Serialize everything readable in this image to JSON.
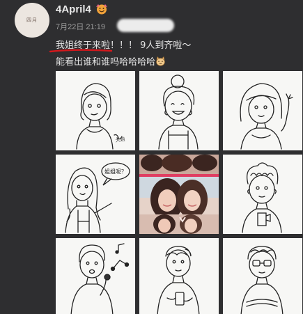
{
  "post": {
    "avatar_text": "四月",
    "username": "4April4",
    "timestamp": "7月22日 21:19",
    "text_line1": "我姐终于来啦！！！ 9人到齐啦～",
    "text_line2": "能看出谁和谁吗哈哈哈哈",
    "badge_icon": "emoji-face-icon",
    "emoji_icon": "cat-face-icon"
  },
  "images": {
    "count": 9,
    "items": [
      {
        "name": "sketch-girl-glasses",
        "caption": ""
      },
      {
        "name": "sketch-girl-bun",
        "caption": ""
      },
      {
        "name": "sketch-girl-bob",
        "caption": ""
      },
      {
        "name": "sketch-girl-speech-bubble",
        "caption": "姐姐呢？"
      },
      {
        "name": "photo-two-girls",
        "caption": ""
      },
      {
        "name": "sketch-boy-curly",
        "caption": ""
      },
      {
        "name": "sketch-boy-singing",
        "caption": ""
      },
      {
        "name": "sketch-boy-phone",
        "caption": ""
      },
      {
        "name": "sketch-boy-glasses",
        "caption": ""
      }
    ]
  },
  "colors": {
    "background": "#2e2e30",
    "text": "#e4e4e4",
    "meta": "#9a9a9a",
    "underline": "#d4181c"
  }
}
